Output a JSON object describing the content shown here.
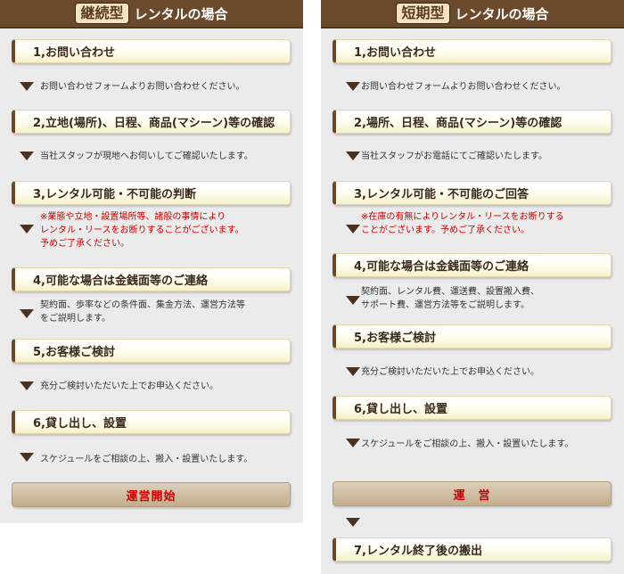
{
  "left": {
    "header_tag": "継続型",
    "header_rest": "レンタルの場合",
    "steps": [
      {
        "title": "1,お問い合わせ",
        "desc": "お問い合わせフォームよりお問い合わせください。"
      },
      {
        "title": "2,立地(場所)、日程、商品(マシーン)等の確認",
        "desc": "当社スタッフが現地へお伺いしてご確認いたします。"
      },
      {
        "title": "3,レンタル可能・不可能の判断",
        "desc_lines": [
          "※業態や立地・設置場所等、諸般の事情により",
          "レンタル・リースをお断りすることがございます。",
          "予めご了承ください。"
        ]
      },
      {
        "title": "4,可能な場合は金銭面等のご連絡",
        "desc_lines": [
          "契約面、歩率などの条件面、集金方法、運営方法等",
          "をご説明します。"
        ]
      },
      {
        "title": "5,お客様ご検討",
        "desc": "充分ご検討いただいた上でお申込ください。"
      },
      {
        "title": "6,貸し出し、設置",
        "desc": "スケジュールをご相談の上、搬入・設置いたします。"
      }
    ],
    "final_label": "運営開始"
  },
  "right": {
    "header_tag": "短期型",
    "header_rest": "レンタルの場合",
    "steps": [
      {
        "title": "1,お問い合わせ",
        "desc": "お問い合わせフォームよりお問い合わせください。"
      },
      {
        "title": "2,場所、日程、商品(マシーン)等の確認",
        "desc": "当社スタッフがお電話にてご確認いたします。"
      },
      {
        "title": "3,レンタル可能・不可能のご回答",
        "desc_lines": [
          "※在庫の有無によりレンタル・リースをお断りする",
          "ことがございます。予めご了承ください。"
        ]
      },
      {
        "title": "4,可能な場合は金銭面等のご連絡",
        "desc_lines": [
          "契約面、レンタル費、運送費、設置搬入費、",
          "サポート費、運営方法等をご説明します。"
        ]
      },
      {
        "title": "5,お客様ご検討",
        "desc": "充分ご検討いただいた上でお申込ください。"
      },
      {
        "title": "6,貸し出し、設置",
        "desc": "スケジュールをご相談の上、搬入・設置いたします。"
      }
    ],
    "final_label": "運　営",
    "after_step": {
      "title": "7,レンタル終了後の搬出"
    }
  },
  "colors": {
    "header_bg": "#6b4a2c",
    "tag_bg": "#f3e3c3",
    "step_accent": "#6b4a2c",
    "note_red": "#cc0000",
    "arrow": "#4a3220",
    "panel_bg": "#ebebeb"
  }
}
